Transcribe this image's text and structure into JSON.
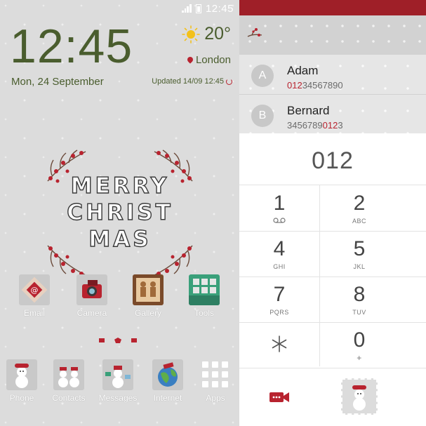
{
  "status_bar": {
    "time": "12:45"
  },
  "clock": {
    "time": "12:45",
    "date": "Mon, 24 September"
  },
  "weather": {
    "temperature": "20°",
    "location": "London",
    "updated": "Updated 14/09 12:45"
  },
  "greeting": {
    "line1": "MERRY",
    "line2": "CHRIST",
    "line3": "MAS"
  },
  "apps_row1": [
    {
      "label": "Email",
      "icon": "email-icon"
    },
    {
      "label": "Camera",
      "icon": "camera-icon"
    },
    {
      "label": "Gallery",
      "icon": "gallery-icon"
    },
    {
      "label": "Tools",
      "icon": "tools-icon"
    }
  ],
  "dock": [
    {
      "label": "Phone",
      "icon": "phone-snowman-icon"
    },
    {
      "label": "Contacts",
      "icon": "contacts-snowmen-icon"
    },
    {
      "label": "Messages",
      "icon": "messages-snowman-icon"
    },
    {
      "label": "Internet",
      "icon": "globe-icon"
    },
    {
      "label": "Apps",
      "icon": "apps-grid-icon"
    }
  ],
  "dialer": {
    "input": "012",
    "contacts": [
      {
        "initial": "A",
        "name": "Adam",
        "number_match": "012",
        "number_rest": "34567890"
      },
      {
        "initial": "B",
        "name": "Bernard",
        "number_pre": "3456789",
        "number_match": "012",
        "number_rest": "3"
      }
    ],
    "keys": [
      {
        "digit": "1",
        "letters": ""
      },
      {
        "digit": "2",
        "letters": "ABC"
      },
      {
        "digit": "4",
        "letters": "GHI"
      },
      {
        "digit": "5",
        "letters": "JKL"
      },
      {
        "digit": "7",
        "letters": "PQRS"
      },
      {
        "digit": "8",
        "letters": "TUV"
      },
      {
        "digit": "0",
        "letters": "+"
      }
    ]
  },
  "colors": {
    "accent_red": "#b8232f",
    "clock_green": "#4a5d2e",
    "header_red": "#9f1f28"
  }
}
